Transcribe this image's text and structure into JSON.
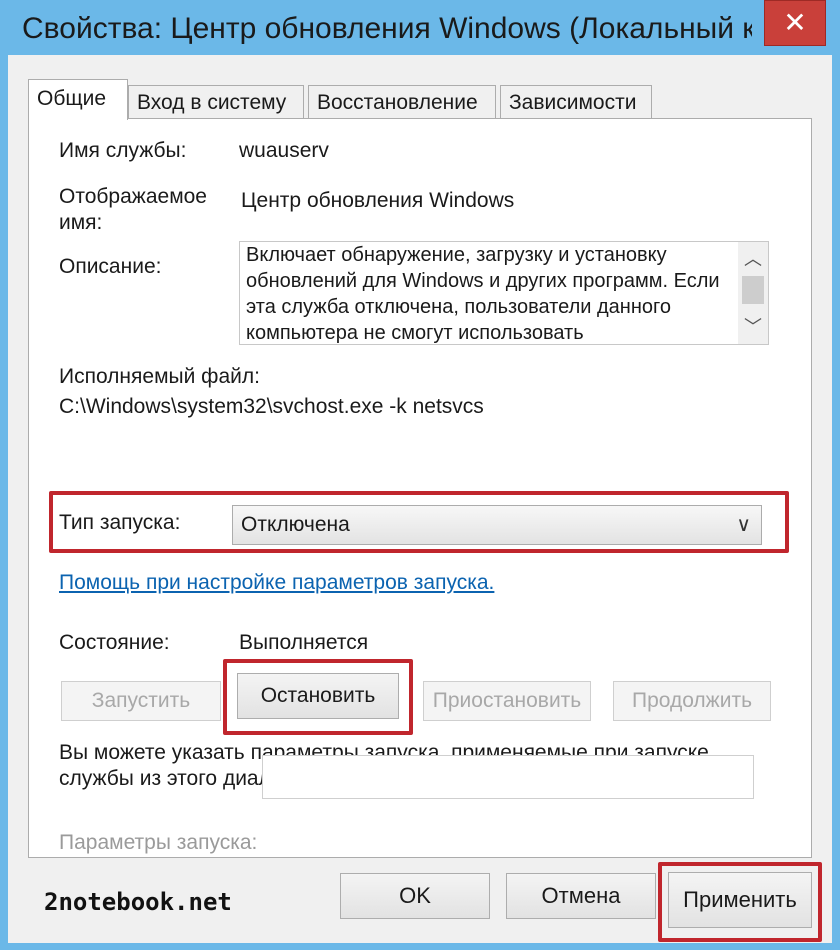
{
  "window": {
    "title": "Свойства: Центр обновления Windows (Локальный к...",
    "close_label": "✕"
  },
  "tabs": [
    {
      "label": "Общие",
      "active": true
    },
    {
      "label": "Вход в систему",
      "active": false
    },
    {
      "label": "Восстановление",
      "active": false
    },
    {
      "label": "Зависимости",
      "active": false
    }
  ],
  "general": {
    "service_name_label": "Имя службы:",
    "service_name_value": "wuauserv",
    "display_name_label_line1": "Отображаемое",
    "display_name_label_line2": "имя:",
    "display_name_value": "Центр обновления Windows",
    "description_label": "Описание:",
    "description_text": "Включает обнаружение, загрузку и установку обновлений для Windows и других программ. Если эта служба отключена, пользователи данного компьютера не смогут использовать",
    "executable_label": "Исполняемый файл:",
    "executable_value": "C:\\Windows\\system32\\svchost.exe -k netsvcs",
    "startup_type_label": "Тип запуска:",
    "startup_type_value": "Отключена",
    "startup_help_link": "Помощь при настройке параметров запуска.",
    "status_label": "Состояние:",
    "status_value": "Выполняется",
    "buttons": {
      "start": "Запустить",
      "stop": "Остановить",
      "pause": "Приостановить",
      "resume": "Продолжить"
    },
    "hint_text_line1": "Вы можете указать параметры запуска, применяемые при запуске",
    "hint_text_line2": "службы из этого диалогового окна.",
    "start_params_label": "Параметры запуска:",
    "start_params_value": ""
  },
  "footer": {
    "ok": "OK",
    "cancel": "Отмена",
    "apply": "Применить",
    "watermark": "2notebook.net"
  },
  "colors": {
    "highlight": "#c0262d",
    "link": "#0b63b0",
    "window_frame": "#6bb8e8",
    "close_button": "#c9403a"
  }
}
